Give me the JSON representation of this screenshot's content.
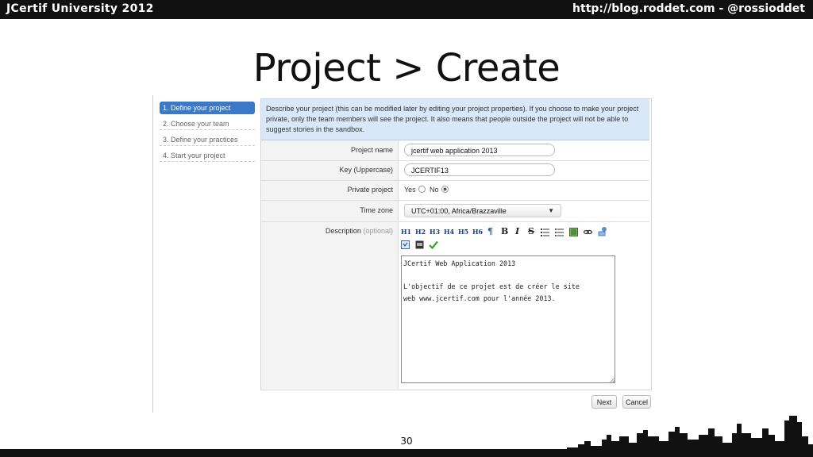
{
  "header": {
    "left_title": "JCertif University 2012",
    "right_text": "http://blog.roddet.com  -  @rossioddet"
  },
  "slide": {
    "title": "Project > Create",
    "page_number": "30"
  },
  "wizard": {
    "steps": [
      {
        "label": "1. Define your project",
        "active": true
      },
      {
        "label": "2. Choose your team",
        "active": false
      },
      {
        "label": "3. Define your practices",
        "active": false
      },
      {
        "label": "4. Start your project",
        "active": false
      }
    ]
  },
  "form": {
    "description": "Describe your project (this can be modified later by editing your project properties). If you choose to make your project private, only the team members will see the project. It also means that people outside the project will not be able to suggest stories in the sandbox.",
    "project_name_label": "Project name",
    "project_name_value": "jcertif web application 2013",
    "key_label": "Key (Uppercase)",
    "key_value": "JCERTIF13",
    "private_label": "Private project",
    "private_yes": "Yes",
    "private_no": "No",
    "private_selected": "No",
    "timezone_label": "Time zone",
    "timezone_value": "UTC+01:00, Africa/Brazzaville",
    "description_label": "Description",
    "description_optional": "(optional)",
    "editor_text": "JCertif Web Application 2013\n\nL'objectif de ce projet est de créer le site\nweb www.jcertif.com pour l'année 2013.",
    "toolbar_headings": [
      "H1",
      "H2",
      "H3",
      "H4",
      "H5",
      "H6"
    ],
    "toolbar_symbols": [
      "¶",
      "B",
      "I",
      "S"
    ],
    "next_label": "Next",
    "cancel_label": "Cancel"
  }
}
